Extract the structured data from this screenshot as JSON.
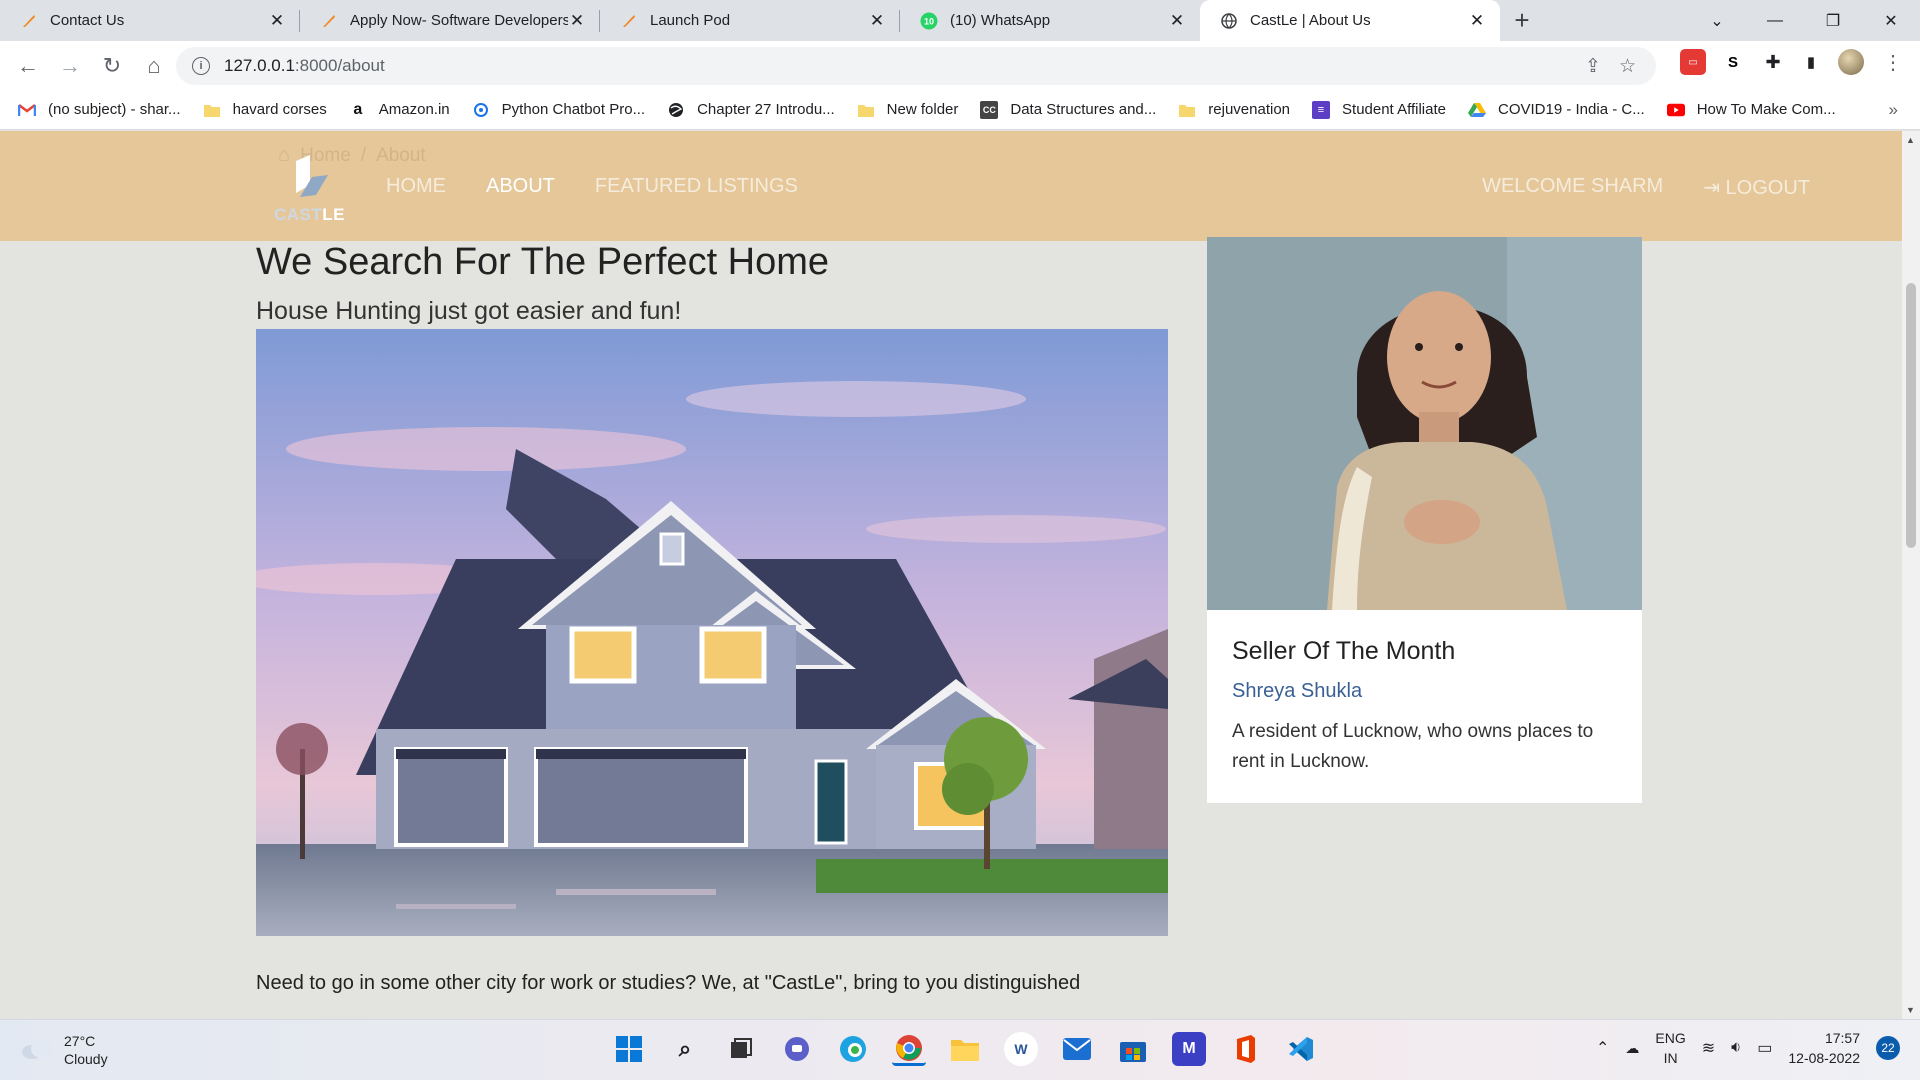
{
  "browser": {
    "tabs": [
      {
        "title": "Contact Us",
        "icon": "quill-icon",
        "active": false
      },
      {
        "title": "Apply Now- Software Developers",
        "icon": "quill-icon",
        "active": false
      },
      {
        "title": "Launch Pod",
        "icon": "quill-icon",
        "active": false
      },
      {
        "title": "(10) WhatsApp",
        "icon": "whatsapp-icon",
        "active": false
      },
      {
        "title": "CastLe | About Us",
        "icon": "globe-icon",
        "active": true
      }
    ],
    "url_host": "127.0.0.1",
    "url_path": ":8000/about",
    "bookmarks": [
      {
        "label": "(no subject) - shar...",
        "icon": "gmail-icon"
      },
      {
        "label": "havard corses",
        "icon": "folder-icon"
      },
      {
        "label": "Amazon.in",
        "icon": "amazon-icon"
      },
      {
        "label": "Python Chatbot Pro...",
        "icon": "link-icon"
      },
      {
        "label": "Chapter 27 Introdu...",
        "icon": "globe-icon"
      },
      {
        "label": "New folder",
        "icon": "folder-icon"
      },
      {
        "label": "Data Structures and...",
        "icon": "cc-icon"
      },
      {
        "label": "rejuvenation",
        "icon": "folder-icon"
      },
      {
        "label": "Student Affiliate",
        "icon": "list-icon"
      },
      {
        "label": "COVID19 - India - C...",
        "icon": "drive-icon"
      },
      {
        "label": "How To Make Com...",
        "icon": "youtube-icon"
      }
    ],
    "whatsapp_badge": "10"
  },
  "site": {
    "breadcrumb": {
      "home": "Home",
      "current": "About"
    },
    "logo": {
      "part1": "CAST",
      "part2": "LE"
    },
    "nav": {
      "home": "HOME",
      "about": "ABOUT",
      "featured": "FEATURED LISTINGS"
    },
    "welcome": "WELCOME SHARM",
    "logout": "LOGOUT"
  },
  "main": {
    "heading": "We Search For The Perfect Home",
    "lead": "House Hunting just got easier and fun!",
    "body": "Need to go in some other city for work or studies? We, at \"CastLe\", bring to you distinguished"
  },
  "seller": {
    "title": "Seller Of The Month",
    "name": "Shreya Shukla",
    "description": "A resident of Lucknow, who owns places to rent in Lucknow."
  },
  "taskbar": {
    "temperature": "27°C",
    "condition": "Cloudy",
    "lang_top": "ENG",
    "lang_bottom": "IN",
    "time": "17:57",
    "date": "12-08-2022",
    "notification_count": "22"
  },
  "colors": {
    "nav_bg": "#e5c799",
    "page_bg": "#e3e4df",
    "seller_name": "#3a5f96"
  }
}
